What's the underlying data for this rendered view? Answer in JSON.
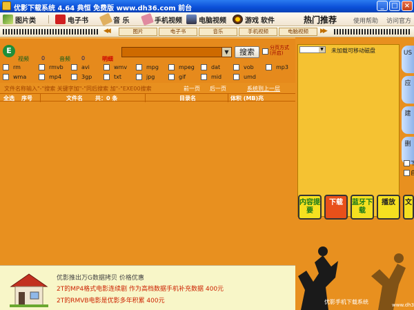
{
  "window": {
    "title": "优影下载系统 4.64 典恒 免费版 www.dh36.com 前台",
    "min": "_",
    "max": "□",
    "close": "×"
  },
  "menu": {
    "pictures": "图片类",
    "ebooks": "电子书",
    "music": "音 乐",
    "mobile_video": "手机视频",
    "pc_video": "电脑视频",
    "games": "游戏",
    "software": "软件",
    "hot": "热门推荐",
    "help": "使用帮助",
    "visit": "访问官方"
  },
  "subnav": {
    "tabs": [
      "图片",
      "电子书",
      "音乐",
      "手机视频",
      "电脑视频"
    ]
  },
  "search": {
    "logo": "E",
    "labels": [
      "视频",
      "0",
      "音频",
      "0"
    ],
    "detail": "明细",
    "button": "搜索",
    "split_label": "分页方式(开启)"
  },
  "extensions": [
    [
      "rm",
      "rmvb",
      "avi",
      "wmv",
      "mpg",
      "mpeg",
      "dat",
      "vob",
      "mp3"
    ],
    [
      "wma",
      "mp4",
      "3gp",
      "txt",
      "jpg",
      "gif",
      "mid",
      "umd"
    ]
  ],
  "hint": {
    "text": "文件名称输入\"-\"搜索   关键字加\"-\"同后搜索 加\"-\"EXE00搜索",
    "prev": "前一页",
    "next": "后一页",
    "system": "系统到上一层"
  },
  "table": {
    "select_all": "全选",
    "index": "序号",
    "filename": "文件名",
    "total": "共：0 条",
    "directory": "目录名",
    "size": "体积 (MB)兆"
  },
  "right": {
    "drive_placeholder": "",
    "message": "未加载可移动磁盘",
    "side_tabs": [
      "US",
      "应",
      "建",
      "删",
      "文"
    ],
    "side_checks": [
      "下",
      "自"
    ],
    "actions": [
      "内容提要",
      "下载",
      "蓝牙下载",
      "播放",
      "文"
    ]
  },
  "promo": {
    "line1": "优影推出万G数据拷贝 价格优惠",
    "line2": "2T的MP4格式电影连续剧 作为高档数据手机补充数据 400元",
    "line3": "2T的RMVB电影是优影多年积累 400元"
  },
  "watermark": {
    "text": "优影手机下载系统",
    "site": "www.dh36.com"
  },
  "colors": {
    "panel": "#e8901f",
    "yellow": "#f5c232",
    "title": "#0a4fd8"
  }
}
